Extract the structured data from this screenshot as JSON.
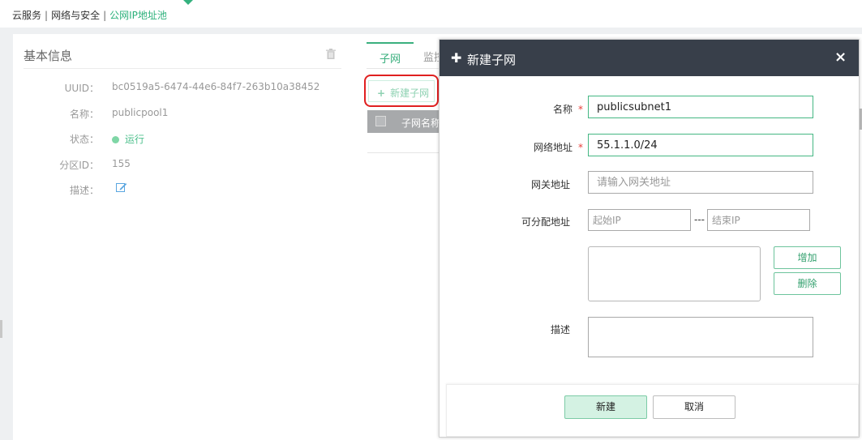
{
  "breadcrumb": {
    "items": [
      "云服务",
      "网络与安全",
      "公网IP地址池"
    ],
    "separator": "|"
  },
  "basic_info": {
    "title": "基本信息",
    "rows": [
      {
        "label": "UUID：",
        "value": "bc0519a5-6474-44e6-84f7-263b10a38452"
      },
      {
        "label": "名称：",
        "value": "publicpool1"
      },
      {
        "label": "状态：",
        "value": "运行"
      },
      {
        "label": "分区ID：",
        "value": "155"
      },
      {
        "label": "描述：",
        "value": ""
      }
    ],
    "status_color": "#7fd6a6"
  },
  "tabs": {
    "subnet": "子网",
    "monitor": "监控"
  },
  "subnet_panel": {
    "new_button": "新建子网",
    "columns": [
      "子网名称"
    ]
  },
  "modal": {
    "title": "新建子网",
    "close_symbol": "×",
    "fields": {
      "name": {
        "label": "名称",
        "required": "*",
        "value": "publicsubnet1"
      },
      "network": {
        "label": "网络地址",
        "required": "*",
        "value": "55.1.1.0/24"
      },
      "gateway": {
        "label": "网关地址",
        "placeholder": "请输入网关地址",
        "value": ""
      },
      "allocatable": {
        "label": "可分配地址",
        "start_placeholder": "起始IP",
        "end_placeholder": "结束IP",
        "separator": "---"
      },
      "description": {
        "label": "描述",
        "value": ""
      }
    },
    "add_button": "增加",
    "delete_button": "删除",
    "ok_button": "新建",
    "cancel_button": "取消"
  },
  "colors": {
    "accent": "#2bb07a",
    "modal_header": "#383f4a",
    "required": "#e8413c",
    "highlight_outline": "#e02020"
  }
}
